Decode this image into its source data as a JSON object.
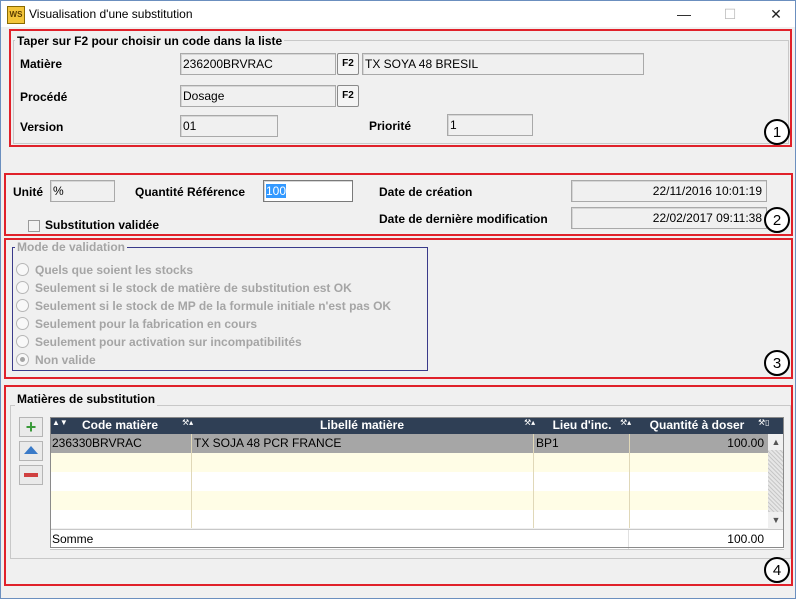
{
  "window": {
    "title": "Visualisation d'une substitution",
    "minimize": "—",
    "maximize": "☐",
    "close": "✕"
  },
  "section1": {
    "hint": "Taper sur F2 pour choisir un code dans la liste",
    "matiere_label": "Matière",
    "matiere_code": "236200BRVRAC",
    "matiere_f2": "F2",
    "matiere_libelle": "TX SOYA 48 BRESIL",
    "procede_label": "Procédé",
    "procede_value": "Dosage",
    "procede_f2": "F2",
    "version_label": "Version",
    "version_value": "01",
    "priorite_label": "Priorité",
    "priorite_value": "1",
    "marker": "1"
  },
  "section2": {
    "unite_label": "Unité",
    "unite_value": "%",
    "qte_ref_label": "Quantité Référence",
    "qte_ref_value": "100",
    "date_creation_label": "Date de création",
    "date_creation_value": "22/11/2016 10:01:19",
    "date_modif_label": "Date de dernière modification",
    "date_modif_value": "22/02/2017 09:11:38",
    "substitution_validee_label": "Substitution validée",
    "marker": "2"
  },
  "section3": {
    "title": "Mode de validation",
    "options": [
      "Quels que soient les stocks",
      "Seulement si le stock de matière de substitution est OK",
      "Seulement si le stock de MP de la formule initiale n'est pas OK",
      "Seulement pour la fabrication en cours",
      "Seulement pour activation sur incompatibilités",
      "Non valide"
    ],
    "selected_index": 5,
    "marker": "3"
  },
  "section4": {
    "title": "Matières de substitution",
    "columns": [
      "Code matière",
      "Libellé matière",
      "Lieu d'inc.",
      "Quantité à doser"
    ],
    "rows": [
      [
        "236330BRVRAC",
        "TX SOJA 48 PCR FRANCE",
        "BP1",
        "100.00"
      ]
    ],
    "sum_label": "Somme",
    "sum_value": "100.00",
    "marker": "4"
  },
  "colors": {
    "accent": "#e0212a",
    "header_bg": "#2f3f55",
    "selected_row": "#a6a6a6",
    "empty_row": "#fffde6",
    "qte_selection": "#3399ff"
  },
  "icons": {
    "add": "plus-icon",
    "up": "arrow-up-icon",
    "remove": "minus-icon"
  }
}
